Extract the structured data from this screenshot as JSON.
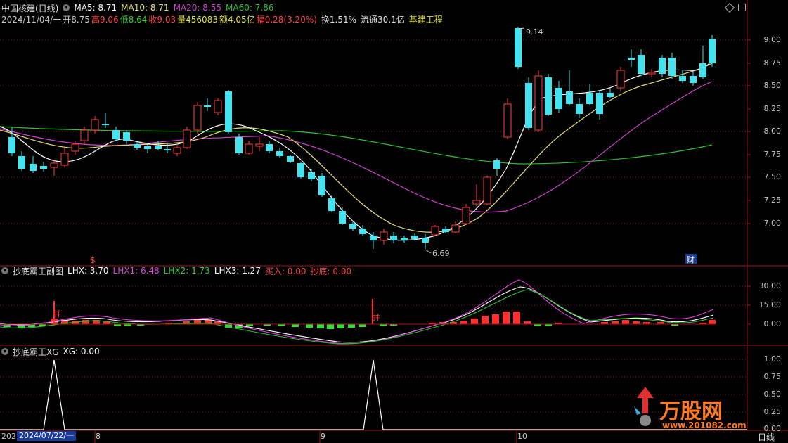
{
  "header": {
    "stock_name": "中国核建(日线)",
    "ma5": "MA5: 8.71",
    "ma10": "MA10: 8.71",
    "ma20": "MA20: 8.55",
    "ma60": "MA60: 7.86",
    "date": "2024/11/04/一",
    "open": "开8.75",
    "high": "高9.06",
    "low": "低8.64",
    "close": "收9.03",
    "volume": "量456083",
    "amount": "额4.05亿",
    "change": "幅0.28(3.20%)",
    "turnover": "换1.51%",
    "float": "流通30.1亿",
    "sector": "基建工程"
  },
  "main_axis": [
    "9.00",
    "8.75",
    "8.50",
    "8.25",
    "8.00",
    "7.75",
    "7.50",
    "7.25",
    "7.00"
  ],
  "annotations": {
    "high_marker": "9.14",
    "low_marker": "6.69",
    "dollar": "$",
    "cai": "财"
  },
  "indicator1": {
    "title": "抄底霸王副图",
    "lhx": "LHX: 3.70",
    "lhx1": "LHX1: 6.48",
    "lhx2": "LHX2: 1.73",
    "lhx3": "LHX3: 1.27",
    "buy": "买入: 0.00",
    "chaodi": "抄底: 0.00",
    "axis": [
      "30.00",
      "15.00",
      "0.00"
    ],
    "bing": "并"
  },
  "indicator2": {
    "title": "抄底霸王XG",
    "xg": "XG: 0.00",
    "axis": [
      "1.00",
      "0.75",
      "0.50",
      "0.25",
      "0.00"
    ]
  },
  "bottom": {
    "year": "202",
    "date_box": "2024/07/22/一",
    "months": [
      "8",
      "9",
      "10"
    ],
    "period": "日线"
  },
  "watermark": {
    "brand": "万股网",
    "url": "www.201082.com"
  },
  "colors": {
    "up": "#ff3b3b",
    "down": "#44e3f0",
    "ma5": "#ffffff",
    "ma10": "#e8e070",
    "ma20": "#d040d0",
    "ma60": "#30c030",
    "grid": "#8a1a1a"
  }
}
